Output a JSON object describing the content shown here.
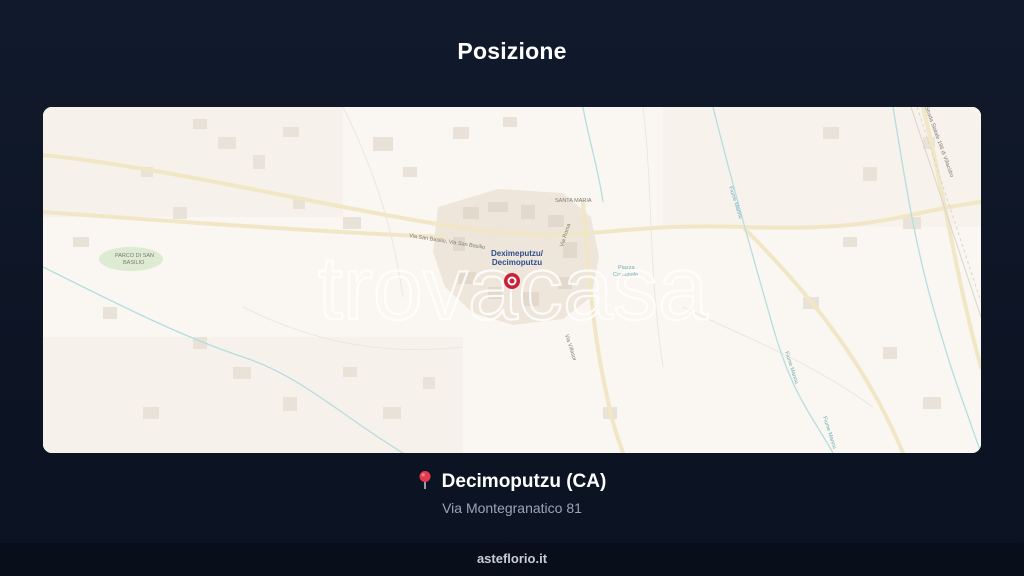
{
  "header": {
    "title": "Posizione"
  },
  "map": {
    "town_label_line1": "Deximeputzu/",
    "town_label_line2": "Decimoputzu",
    "labels": {
      "park": "PARCO DI SAN BASILIO",
      "park_line2": "BASILIO",
      "park_line1": "PARCO DI SAN",
      "road_san_basilio": "Via San Basilio, Via San Basilio",
      "road_roma": "Via Roma",
      "road_villasor": "Via Villasor",
      "road_villacidro": "Strada Statale 196 di Villacidro",
      "river_1": "Fiume Mannu",
      "river_2": "Fiume Mannu",
      "river_3": "Fiume Mannu",
      "piazza": "Piazza Comunale",
      "piazza_line1": "Piazza",
      "piazza_line2": "Comunale",
      "district": "SANTA MARIA",
      "corner_label": "Villacidro"
    },
    "watermark": "trovacasa",
    "colors": {
      "land": "#faf6f1",
      "road": "#f3ecd2",
      "water": "#a7d7dc",
      "marker": "#cc1f3a",
      "label": "#2f4e8c"
    }
  },
  "location": {
    "pin_icon": "map-pin-icon",
    "name": "Decimoputzu (CA)",
    "address": "Via Montegranatico 81"
  },
  "footer": {
    "site": "asteflorio.it"
  }
}
